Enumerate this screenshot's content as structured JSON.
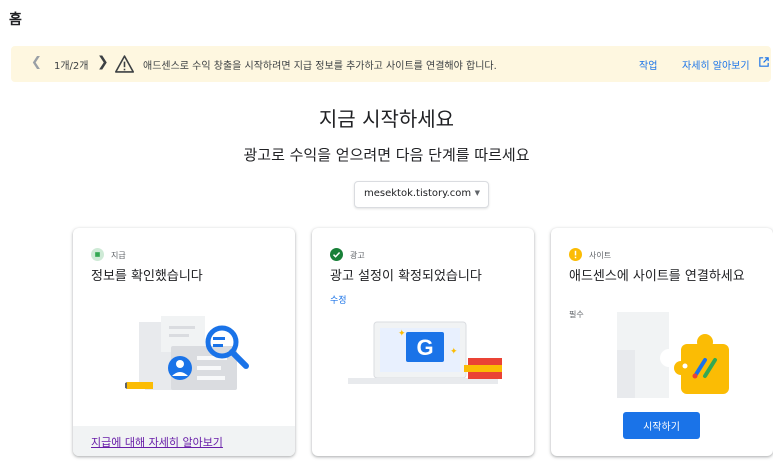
{
  "header": {
    "title": "홈"
  },
  "banner": {
    "counter": "1개/2개",
    "message": "애드센스로 수익 창출을 시작하려면 지급 정보를 추가하고 사이트를 연결해야 합니다.",
    "action_label": "작업",
    "learn_more_label": "자세히 알아보기",
    "prev_icon": "chevron-left-icon",
    "next_icon": "chevron-right-icon",
    "warning_icon": "warning-icon",
    "external_icon": "open-in-new-icon"
  },
  "hero": {
    "title": "지금 시작하세요",
    "subtitle": "광고로 수익을 얻으려면 다음 단계를 따르세요"
  },
  "site_selector": {
    "value": "mesektok.tistory.com"
  },
  "cards": [
    {
      "tag": "지급",
      "title": "정보를 확인했습니다",
      "status": "in-progress",
      "link": "지급에 대해 자세히 알아보기"
    },
    {
      "tag": "광고",
      "title": "광고 설정이 확정되었습니다",
      "status": "complete",
      "edit": "수정"
    },
    {
      "tag": "사이트",
      "title": "애드센스에 사이트를 연결하세요",
      "status": "warning",
      "required": "필수",
      "button": "시작하기"
    }
  ],
  "colors": {
    "accent": "#1a73e8",
    "banner_bg": "#fef7e0",
    "success": "#188038",
    "progress": "#34a853",
    "warning": "#fbbc04",
    "visited_link": "#681da8"
  }
}
